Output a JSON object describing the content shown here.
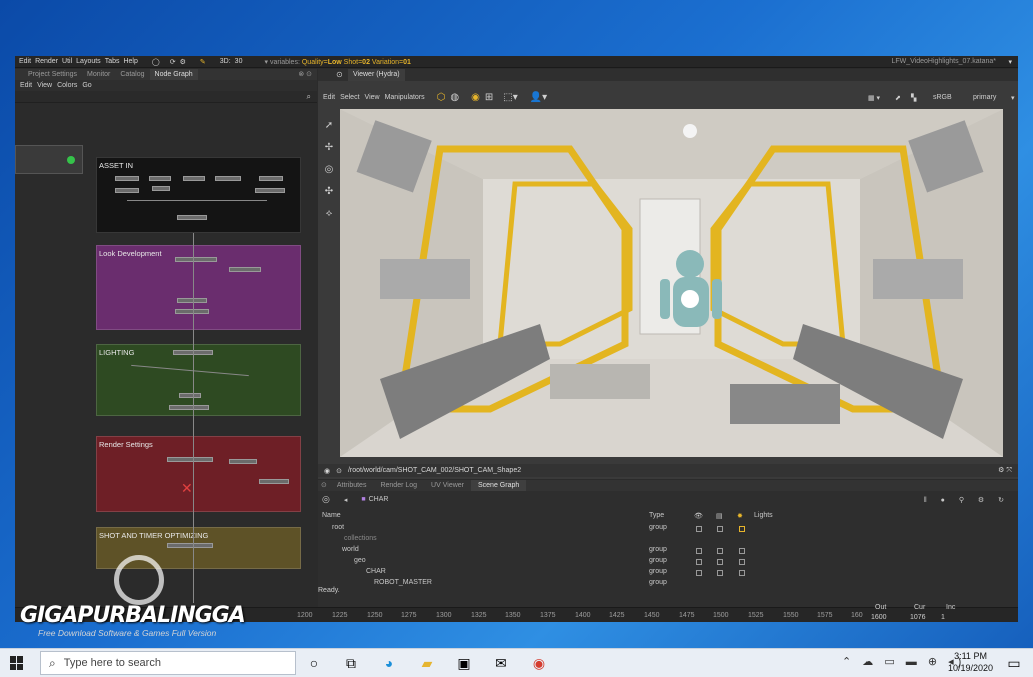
{
  "menubar": {
    "items": [
      "Edit",
      "Render",
      "Util",
      "Layouts",
      "Tabs",
      "Help"
    ],
    "frame": "30",
    "var_prefix": "variables:",
    "var_quality_label": "Quality=",
    "var_quality": "Low",
    "var_shot_label": " Shot=",
    "var_shot": "02",
    "var_variation_label": " Variation=",
    "var_variation": "01",
    "file": "LFW_VideoHighlights_07.katana*"
  },
  "left_panel": {
    "tabs": [
      "Project Settings",
      "Monitor",
      "Catalog",
      "Node Graph"
    ],
    "active_tab": "Node Graph",
    "menu": [
      "Edit",
      "View",
      "Colors",
      "Go"
    ],
    "backdrops": [
      {
        "title": "ASSET IN",
        "color": "#141414"
      },
      {
        "title": "Look Development",
        "color": "#6a2d6e"
      },
      {
        "title": "LIGHTING",
        "color": "#2e4a22"
      },
      {
        "title": "Render Settings",
        "color": "#6e1f26"
      },
      {
        "title": "SHOT AND TIMER OPTIMIZING",
        "color": "#5e5227"
      }
    ]
  },
  "viewer": {
    "tab": "Viewer (Hydra)",
    "menu": [
      "Edit",
      "Select",
      "View",
      "Manipulators"
    ],
    "colorspace": "sRGB",
    "view": "primary",
    "camera_path": "/root/world/cam/SHOT_CAM_002/SHOT_CAM_Shape2"
  },
  "scene_graph": {
    "tabs": [
      "Attributes",
      "Render Log",
      "UV Viewer",
      "Scene Graph"
    ],
    "active_tab": "Scene Graph",
    "breadcrumb": "CHAR",
    "columns": [
      "Name",
      "Type",
      "Lights"
    ],
    "rows": [
      {
        "name": "root",
        "type": "group"
      },
      {
        "name": "collections",
        "type": ""
      },
      {
        "name": "world",
        "type": "group"
      },
      {
        "name": "geo",
        "type": "group"
      },
      {
        "name": "CHAR",
        "type": "group"
      },
      {
        "name": "ROBOT_MASTER",
        "type": "group"
      }
    ],
    "status": "Ready."
  },
  "timeline": {
    "ticks": [
      "1200",
      "1225",
      "1250",
      "1275",
      "1300",
      "1325",
      "1350",
      "1375",
      "1400",
      "1425",
      "1450",
      "1475",
      "1500",
      "1525",
      "1550",
      "1575",
      "160"
    ],
    "out_label": "Out",
    "out": "1600",
    "cur_label": "Cur",
    "cur": "1076",
    "inc_label": "Inc",
    "inc": "1"
  },
  "watermark": {
    "title": "GIGAPURBALINGGA",
    "subtitle": "Free Download Software & Games Full Version"
  },
  "taskbar": {
    "search_placeholder": "Type here to search",
    "time": "3:11 PM",
    "date": "10/19/2020"
  }
}
